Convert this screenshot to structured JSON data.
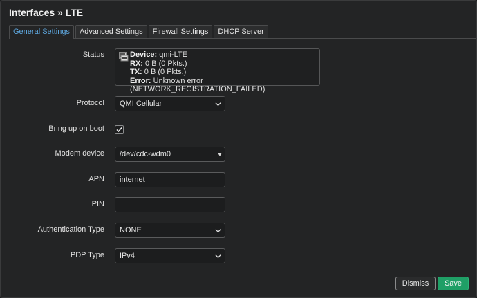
{
  "title": "Interfaces » LTE",
  "tabs": [
    {
      "label": "General Settings",
      "active": true
    },
    {
      "label": "Advanced Settings",
      "active": false
    },
    {
      "label": "Firewall Settings",
      "active": false
    },
    {
      "label": "DHCP Server",
      "active": false
    }
  ],
  "status": {
    "label": "Status",
    "device_key": "Device:",
    "device_val": "qmi-LTE",
    "rx_key": "RX:",
    "rx_val": "0 B (0 Pkts.)",
    "tx_key": "TX:",
    "tx_val": "0 B (0 Pkts.)",
    "error_key": "Error:",
    "error_val": "Unknown error (NETWORK_REGISTRATION_FAILED)",
    "icon": "ethernet-port-icon"
  },
  "protocol": {
    "label": "Protocol",
    "value": "QMI Cellular"
  },
  "boot": {
    "label": "Bring up on boot",
    "checked": true
  },
  "modem": {
    "label": "Modem device",
    "value": "/dev/cdc-wdm0"
  },
  "apn": {
    "label": "APN",
    "value": "internet"
  },
  "pin": {
    "label": "PIN",
    "value": ""
  },
  "auth": {
    "label": "Authentication Type",
    "value": "NONE"
  },
  "pdp": {
    "label": "PDP Type",
    "value": "IPv4"
  },
  "buttons": {
    "dismiss": "Dismiss",
    "save": "Save"
  },
  "colors": {
    "accent": "#5ea8e0",
    "save": "#1f9f66",
    "background": "#232425"
  }
}
